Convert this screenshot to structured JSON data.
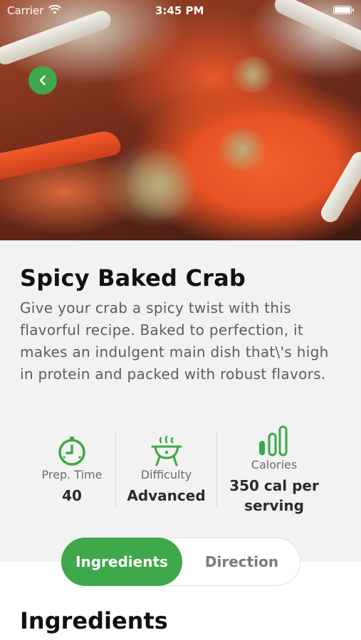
{
  "status_bar": {
    "carrier": "Carrier",
    "time": "3:45 PM"
  },
  "icons": {
    "back": "chevron-left-icon",
    "prep_time": "timer-icon",
    "difficulty": "grill-icon",
    "calories": "signal-bars-icon"
  },
  "colors": {
    "accent": "#3ea84a",
    "background": "#f2f2f2"
  },
  "recipe": {
    "title": "Spicy Baked Crab",
    "description": "Give your crab a spicy twist with this flavorful recipe. Baked to perfection, it makes an indulgent main dish that\\'s high in protein and packed with robust flavors."
  },
  "stats": {
    "prep_time": {
      "label": "Prep. Time",
      "value": "40"
    },
    "difficulty": {
      "label": "Difficulty",
      "value": "Advanced"
    },
    "calories": {
      "label": "Calories",
      "value": "350 cal per serving"
    }
  },
  "tabs": {
    "active": "Ingredients",
    "items": [
      "Ingredients",
      "Direction"
    ]
  },
  "section": {
    "title": "Ingredients"
  }
}
